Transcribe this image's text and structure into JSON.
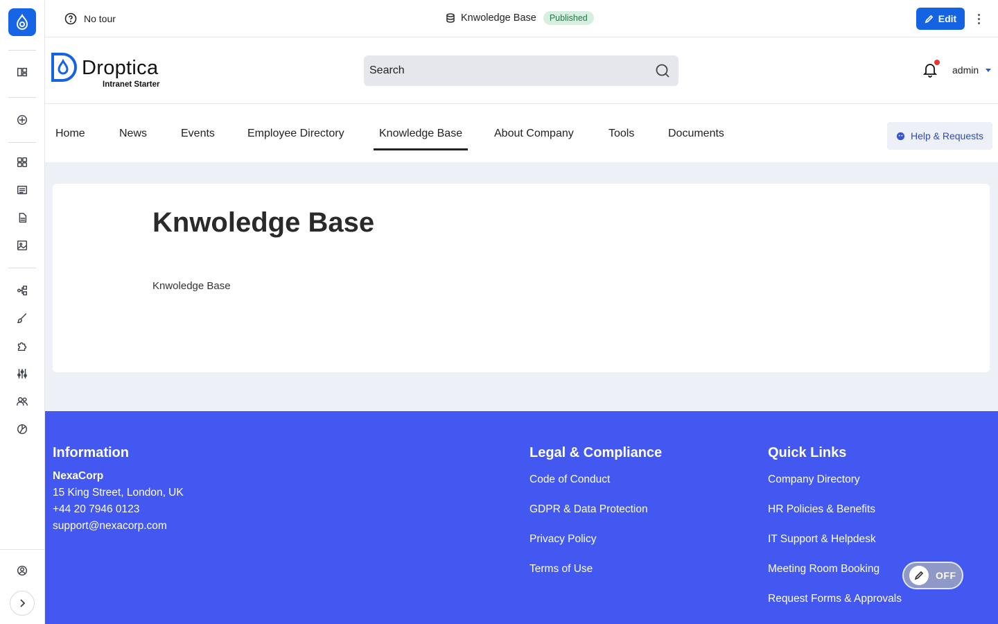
{
  "admin_topbar": {
    "tour_label": "No tour",
    "page_title": "Knwoledge Base",
    "status_badge": "Published",
    "edit_label": "Edit"
  },
  "site_header": {
    "brand_name": "Droptica",
    "brand_subtitle": "Intranet Starter",
    "search_placeholder": "Search",
    "user_name": "admin"
  },
  "main_nav": {
    "items": [
      {
        "label": "Home"
      },
      {
        "label": "News"
      },
      {
        "label": "Events"
      },
      {
        "label": "Employee Directory"
      },
      {
        "label": "Knowledge Base"
      },
      {
        "label": "About Company"
      },
      {
        "label": "Tools"
      },
      {
        "label": "Documents"
      }
    ],
    "active": "Knowledge Base",
    "help_label": "Help & Requests"
  },
  "content": {
    "title": "Knwoledge Base",
    "body": "Knwoledge Base"
  },
  "footer": {
    "information": {
      "heading": "Information",
      "org": "NexaCorp",
      "address": "15 King Street, London, UK",
      "phone": "+44 20 7946 0123",
      "email": "support@nexacorp.com"
    },
    "legal": {
      "heading": "Legal & Compliance",
      "links": [
        "Code of Conduct",
        "GDPR & Data Protection",
        "Privacy Policy",
        "Terms of Use"
      ]
    },
    "quick_links": {
      "heading": "Quick Links",
      "links": [
        "Company Directory",
        "HR Policies & Benefits",
        "IT Support & Helpdesk",
        "Meeting Room Booking",
        "Request Forms & Approvals"
      ]
    }
  },
  "edit_toggle": {
    "label": "OFF"
  },
  "colors": {
    "accent": "#1463e3",
    "footer_bg": "#4358f0",
    "published_bg": "#d7efe0",
    "notification_dot": "#e53935"
  },
  "icons": {
    "sidebar": [
      "drupal-logo-icon",
      "layout-icon",
      "add-circle-icon",
      "dashboard-grid-icon",
      "content-list-icon",
      "files-icon",
      "media-icon",
      "structure-icon",
      "appearance-brush-icon",
      "extend-puzzle-icon",
      "config-sliders-icon",
      "people-icon",
      "reports-chart-icon",
      "user-account-icon",
      "expand-chevron-icon"
    ]
  }
}
